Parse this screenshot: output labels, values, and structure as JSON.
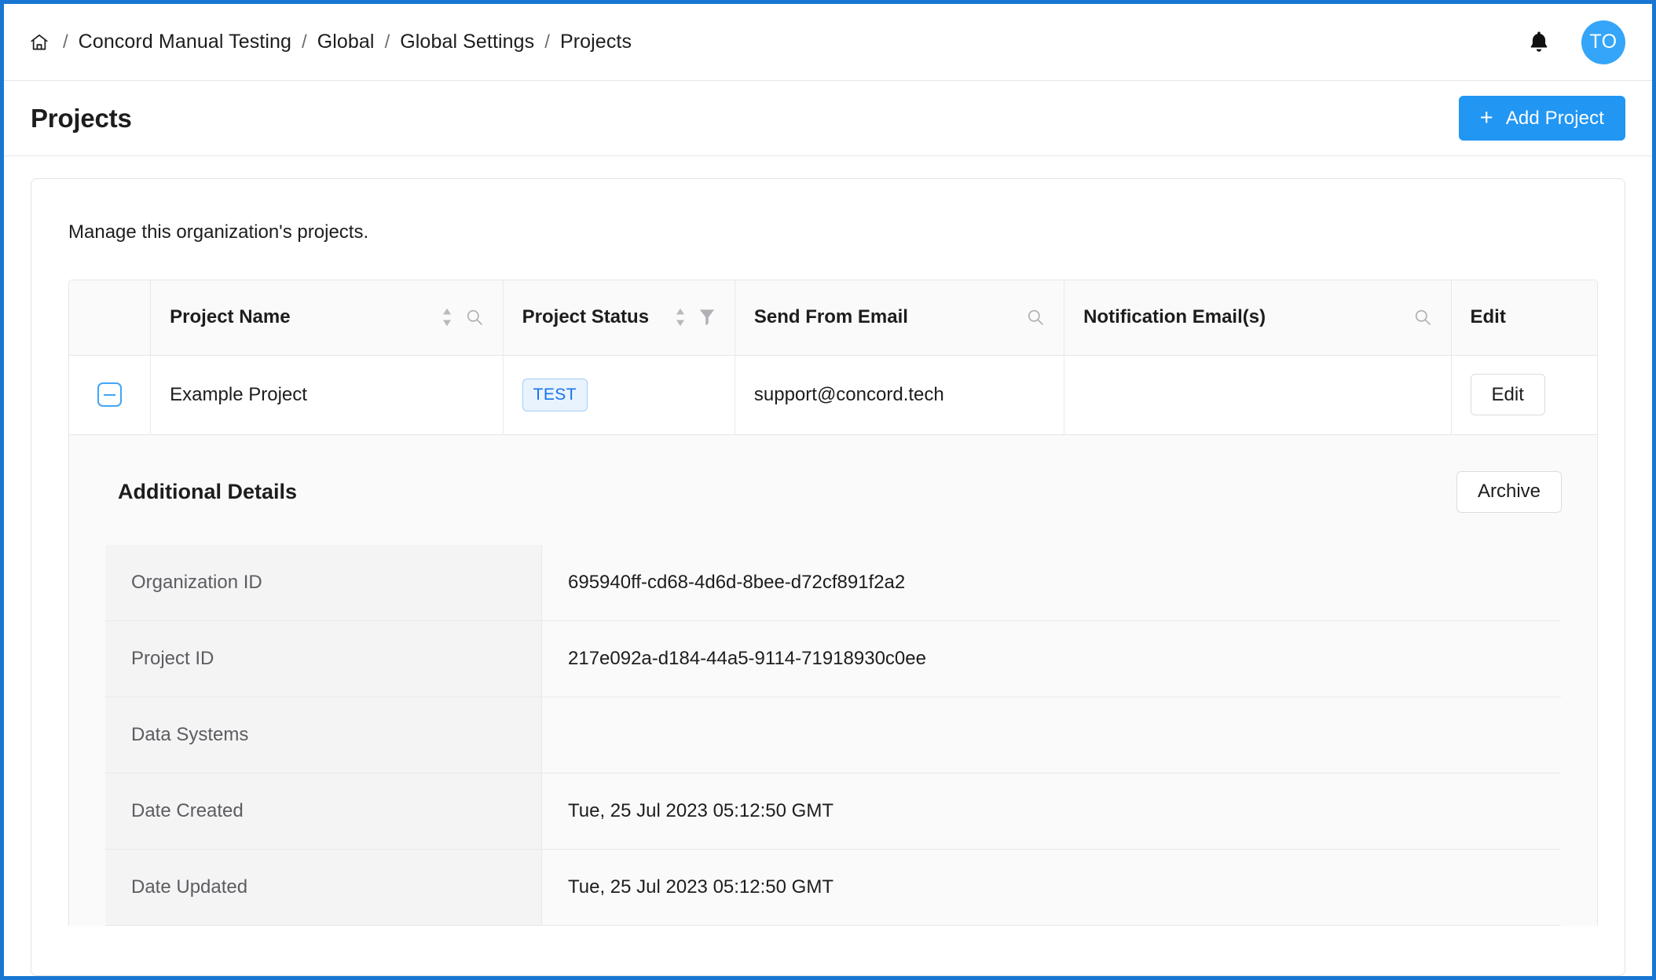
{
  "topbar": {
    "home_icon": "home-icon",
    "breadcrumb": [
      {
        "label": "Concord Manual Testing"
      },
      {
        "label": "Global"
      },
      {
        "label": "Global Settings"
      },
      {
        "label": "Projects"
      }
    ],
    "separator": "/",
    "bell_icon": "bell-icon",
    "avatar_initials": "TO",
    "avatar_color": "#34a5f8"
  },
  "header": {
    "title": "Projects",
    "add_button_label": "Add Project",
    "add_button_plus": "+",
    "accent_color": "#2196f3"
  },
  "card": {
    "intro": "Manage this organization's projects."
  },
  "table": {
    "columns": [
      {
        "label": "Project Name",
        "sort": true,
        "search": true,
        "filter": false
      },
      {
        "label": "Project Status",
        "sort": true,
        "search": false,
        "filter": true
      },
      {
        "label": "Send From Email",
        "sort": false,
        "search": true,
        "filter": false
      },
      {
        "label": "Notification Email(s)",
        "sort": false,
        "search": true,
        "filter": false
      },
      {
        "label": "Edit",
        "sort": false,
        "search": false,
        "filter": false
      }
    ],
    "rows": [
      {
        "expanded": true,
        "project_name": "Example Project",
        "project_status": "TEST",
        "send_from_email": "support@concord.tech",
        "notification_emails": "",
        "edit_label": "Edit"
      }
    ],
    "status_badge_colors": {
      "background": "#e8f3fe",
      "border": "#a5cdf5",
      "text": "#1a73e8"
    }
  },
  "detail": {
    "title": "Additional Details",
    "archive_label": "Archive",
    "rows": [
      {
        "key": "Organization ID",
        "value": "695940ff-cd68-4d6d-8bee-d72cf891f2a2"
      },
      {
        "key": "Project ID",
        "value": "217e092a-d184-44a5-9114-71918930c0ee"
      },
      {
        "key": "Data Systems",
        "value": ""
      },
      {
        "key": "Date Created",
        "value": "Tue, 25 Jul 2023 05:12:50 GMT"
      },
      {
        "key": "Date Updated",
        "value": "Tue, 25 Jul 2023 05:12:50 GMT"
      }
    ]
  }
}
